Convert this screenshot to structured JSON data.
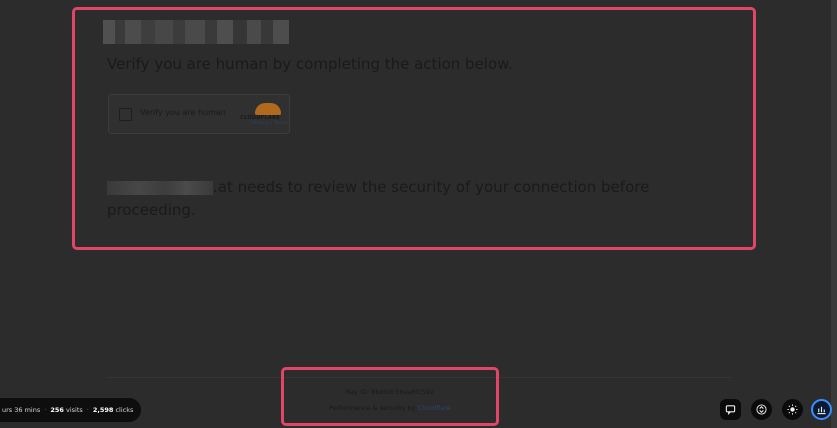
{
  "challenge": {
    "heading": "Verify you are human by completing the action below.",
    "widget": {
      "checkbox_label": "Verify you are human",
      "brand": "CLOUDFLARE",
      "links": "Privacy • Terms"
    },
    "security_message": ".at needs to review the security of your connection before proceeding."
  },
  "footer": {
    "ray_id": "Ray ID: 8bd5dc56ea6fc592",
    "performance_prefix": "Performance & security by ",
    "performance_link": "Cloudflare"
  },
  "stats": {
    "duration": "urs 36 mins",
    "visits": "256",
    "visits_label": "visits",
    "clicks": "2,598",
    "clicks_label": "clicks"
  },
  "toolbar": {
    "icons": [
      "comment-icon",
      "expand-collapse-icon",
      "brightness-icon",
      "chart-icon"
    ],
    "accent": "#3a8fff"
  },
  "colors": {
    "highlight": "#e2456a",
    "background": "#2c2c2c"
  }
}
